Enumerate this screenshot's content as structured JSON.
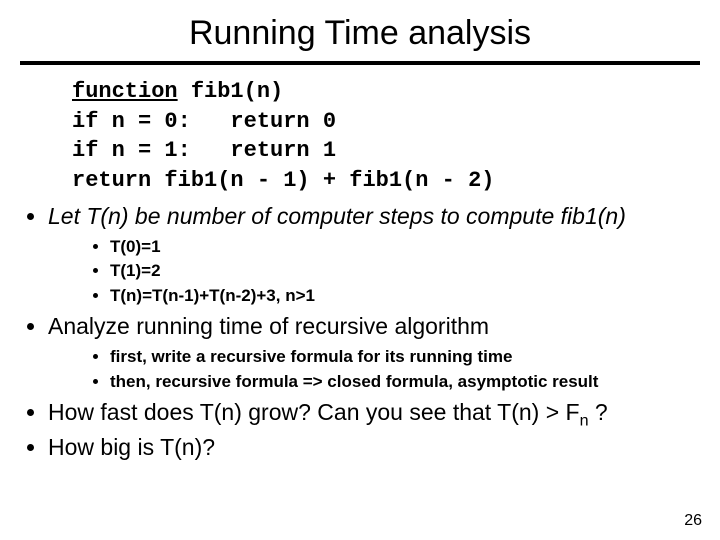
{
  "title": "Running Time analysis",
  "code": {
    "fn_kw": "function",
    "fn_name": "fib1(n)",
    "l2a": "if n = 0:   return 0",
    "l3a": "if n = 1:   return 1",
    "l4a": "return fib1(n - 1) + fib1(n - 2)"
  },
  "bullets": {
    "b1_pre": "Let ",
    "b1_tn": "T(n)",
    "b1_post": " be number of computer steps to compute fib1(n)",
    "b1_sub": [
      "T(0)=1",
      "T(1)=2",
      "T(n)=T(n-1)+T(n-2)+3, n>1"
    ],
    "b2": "Analyze running time of recursive algorithm",
    "b2_sub": [
      "first, write a recursive formula for its running time",
      "then, recursive formula => closed formula, asymptotic result"
    ],
    "b3_pre": "How fast does T(n) grow? Can you see that T(n) > F",
    "b3_sub": "n",
    "b3_post": " ?",
    "b4": "How big is T(n)?"
  },
  "page_number": "26"
}
